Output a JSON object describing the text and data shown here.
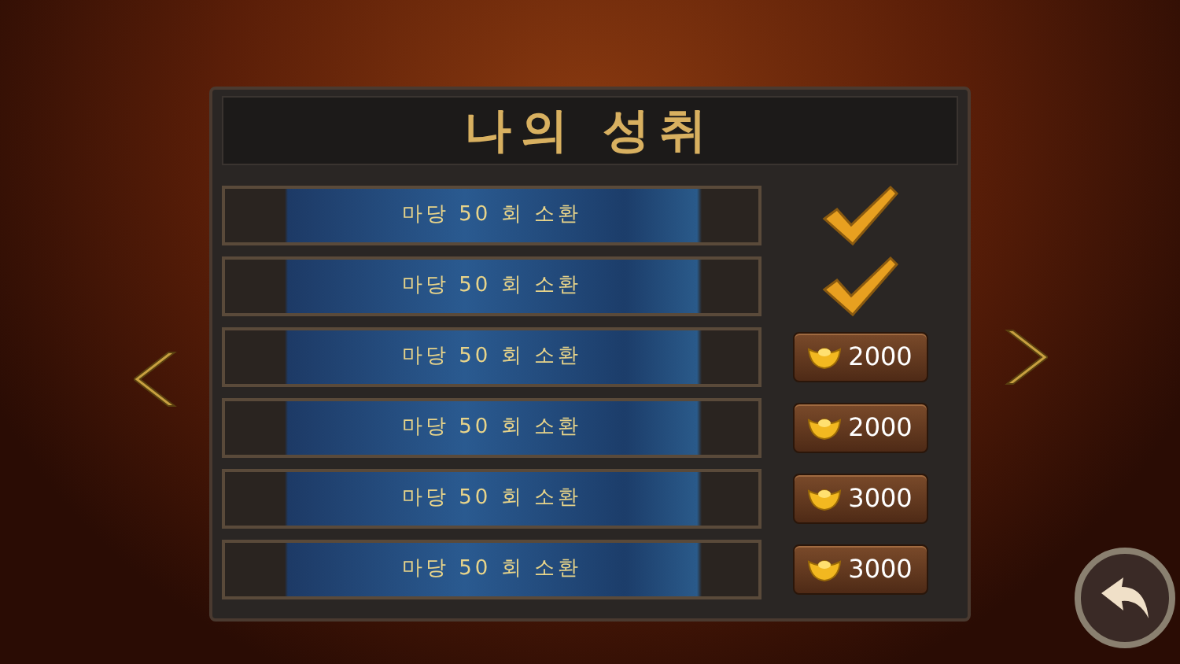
{
  "title": "나의 성취",
  "rows": [
    {
      "label": "마당 50 회 소환",
      "kind": "claimed"
    },
    {
      "label": "마당 50 회 소환",
      "kind": "claimed"
    },
    {
      "label": "마당 50 회 소환",
      "kind": "reward",
      "price": "2000"
    },
    {
      "label": "마당 50 회 소환",
      "kind": "reward",
      "price": "2000"
    },
    {
      "label": "마당 50 회 소환",
      "kind": "reward",
      "price": "3000"
    },
    {
      "label": "마당 50 회 소환",
      "kind": "reward",
      "price": "3000"
    }
  ]
}
